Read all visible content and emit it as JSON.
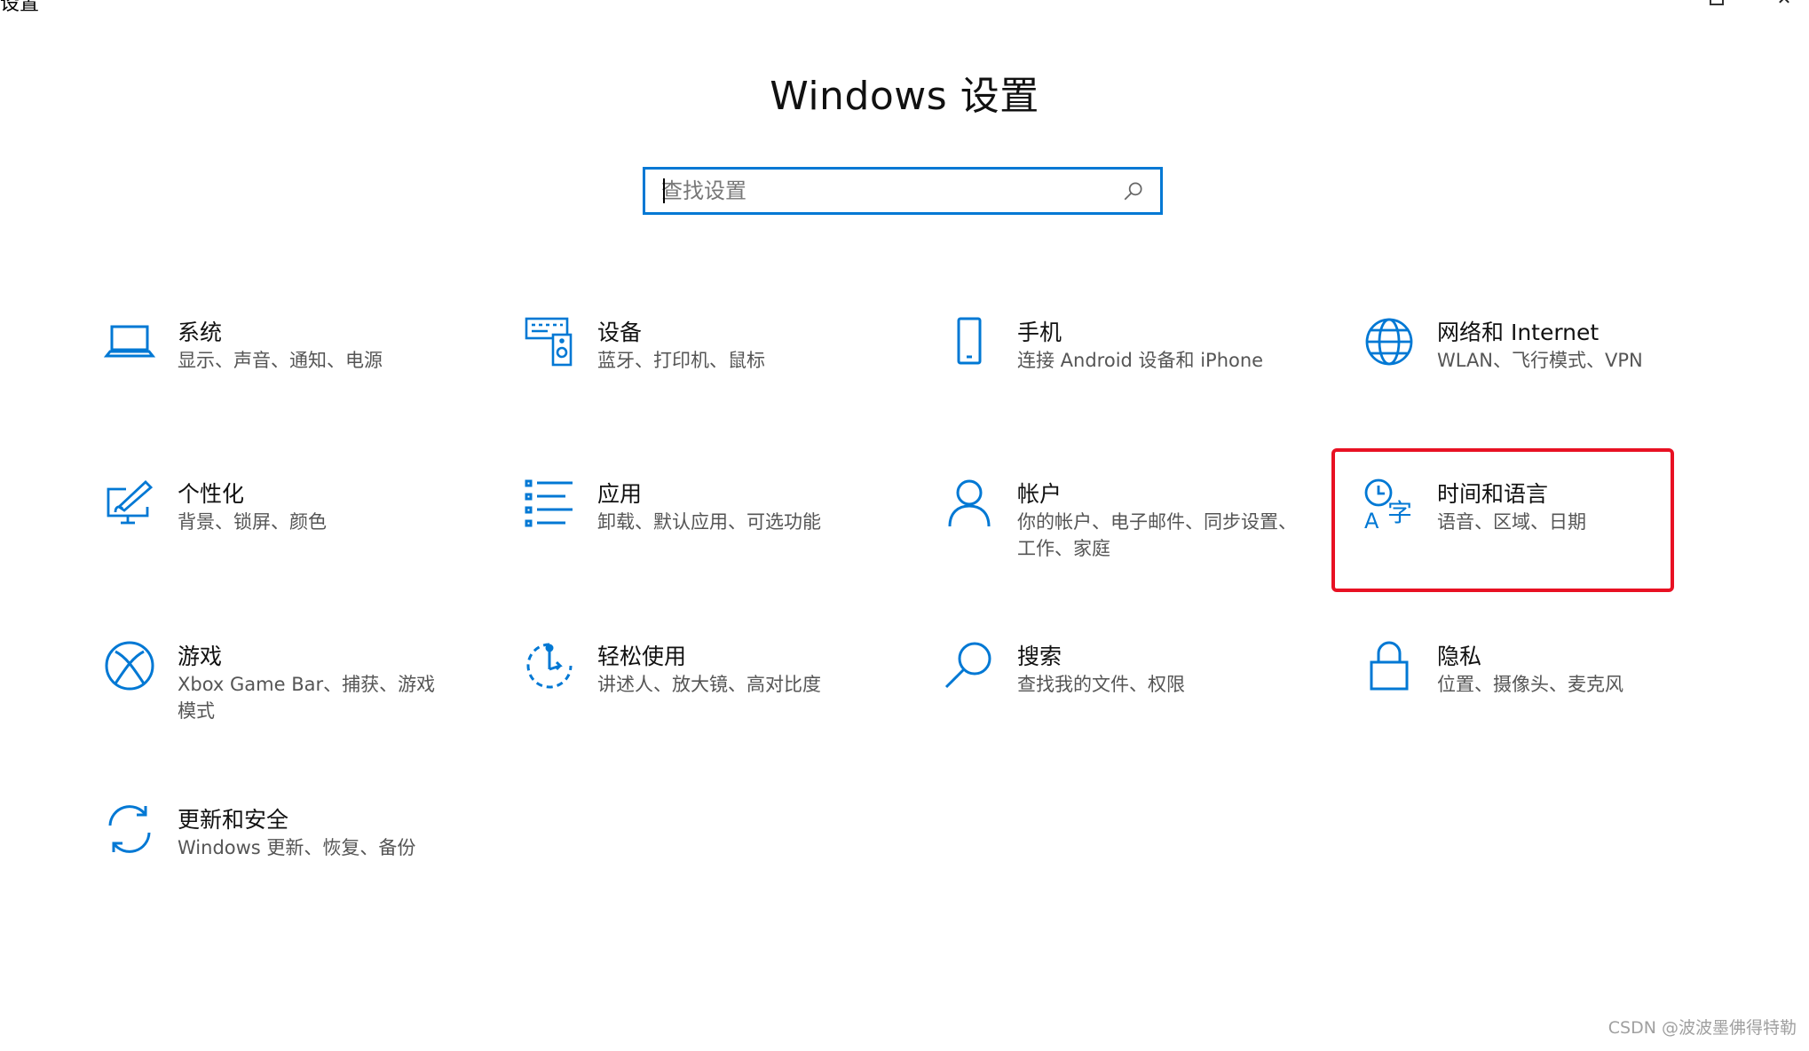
{
  "window": {
    "title": "设置"
  },
  "heading": "Windows 设置",
  "search": {
    "placeholder": "查找设置",
    "icon": "search-icon"
  },
  "tiles": [
    {
      "name": "系统",
      "desc": "显示、声音、通知、电源",
      "icon": "laptop-icon"
    },
    {
      "name": "设备",
      "desc": "蓝牙、打印机、鼠标",
      "icon": "devices-icon"
    },
    {
      "name": "手机",
      "desc": "连接 Android 设备和 iPhone",
      "icon": "phone-icon"
    },
    {
      "name": "网络和 Internet",
      "desc": "WLAN、飞行模式、VPN",
      "icon": "globe-icon"
    },
    {
      "name": "个性化",
      "desc": "背景、锁屏、颜色",
      "icon": "personalization-icon"
    },
    {
      "name": "应用",
      "desc": "卸载、默认应用、可选功能",
      "icon": "apps-list-icon"
    },
    {
      "name": "帐户",
      "desc": "你的帐户、电子邮件、同步设置、工作、家庭",
      "icon": "person-icon"
    },
    {
      "name": "时间和语言",
      "desc": "语音、区域、日期",
      "icon": "time-language-icon"
    },
    {
      "name": "游戏",
      "desc": "Xbox Game Bar、捕获、游戏模式",
      "icon": "xbox-icon"
    },
    {
      "name": "轻松使用",
      "desc": "讲述人、放大镜、高对比度",
      "icon": "ease-of-access-icon"
    },
    {
      "name": "搜索",
      "desc": "查找我的文件、权限",
      "icon": "search-icon"
    },
    {
      "name": "隐私",
      "desc": "位置、摄像头、麦克风",
      "icon": "lock-icon"
    },
    {
      "name": "更新和安全",
      "desc": "Windows 更新、恢复、备份",
      "icon": "update-sync-icon"
    }
  ],
  "highlight": {
    "target": "时间和语言",
    "color": "#e81123"
  },
  "accent_color": "#0078d4",
  "watermark": "CSDN @波波墨佛得特勒"
}
